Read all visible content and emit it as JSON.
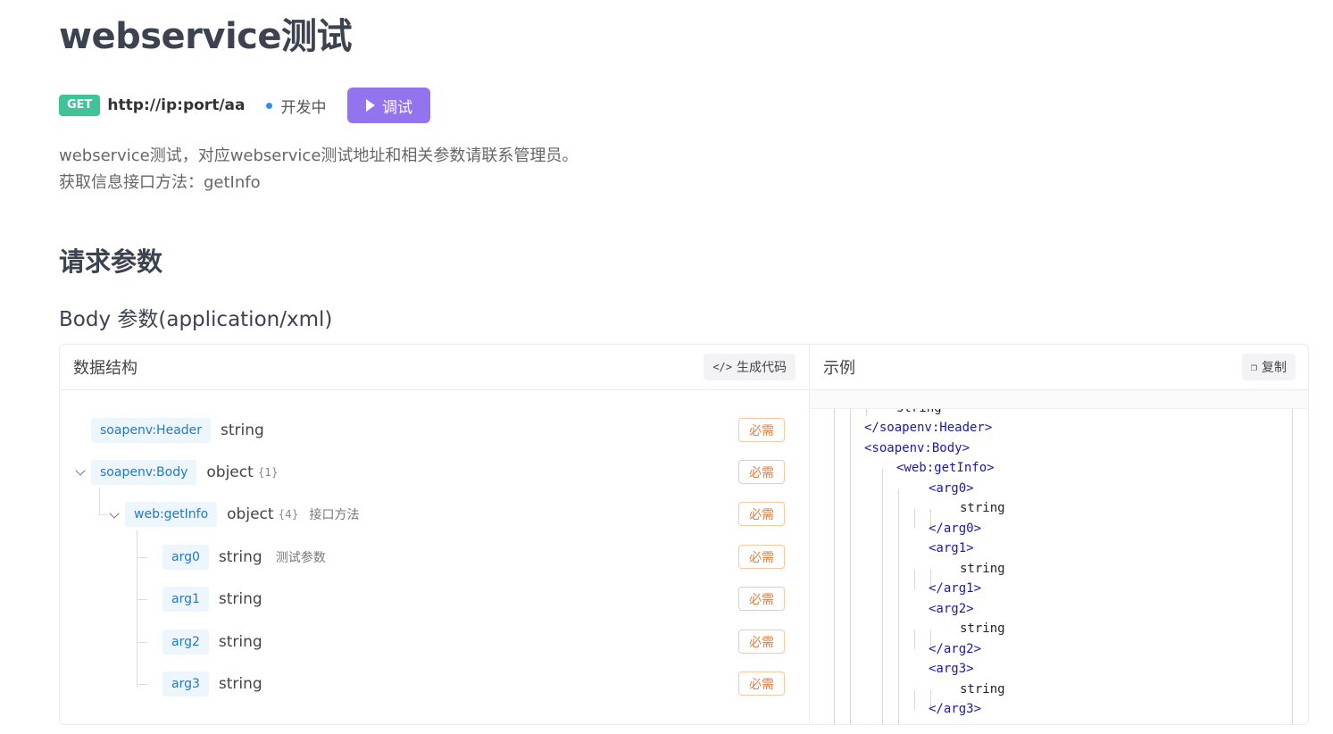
{
  "page": {
    "title": "webservice测试"
  },
  "endpoint": {
    "method": "GET",
    "url": "http://ip:port/aa",
    "status": "开发中",
    "debug_label": "调试"
  },
  "description": {
    "line1": "webservice测试，对应webservice测试地址和相关参数请联系管理员。",
    "line2": "获取信息接口方法：getInfo"
  },
  "request": {
    "section_title": "请求参数",
    "body_title": "Body 参数(application/xml)"
  },
  "schema_pane": {
    "title": "数据结构",
    "generate_code_label": "生成代码",
    "required_label": "必需",
    "rows": [
      {
        "name": "soapenv:Header",
        "type": "string",
        "count": "",
        "desc": ""
      },
      {
        "name": "soapenv:Body",
        "type": "object",
        "count": "{1}",
        "desc": ""
      },
      {
        "name": "web:getInfo",
        "type": "object",
        "count": "{4}",
        "desc": "接口方法"
      },
      {
        "name": "arg0",
        "type": "string",
        "count": "",
        "desc": "测试参数"
      },
      {
        "name": "arg1",
        "type": "string",
        "count": "",
        "desc": ""
      },
      {
        "name": "arg2",
        "type": "string",
        "count": "",
        "desc": ""
      },
      {
        "name": "arg3",
        "type": "string",
        "count": "",
        "desc": ""
      }
    ]
  },
  "example_pane": {
    "title": "示例",
    "copy_label": "复制",
    "code_lines": [
      {
        "text": "string",
        "kind": "text"
      },
      {
        "text": "</soapenv:Header>",
        "kind": "tag"
      },
      {
        "text": "<soapenv:Body>",
        "kind": "tag"
      },
      {
        "text": "<web:getInfo>",
        "kind": "tag"
      },
      {
        "text": "<arg0>",
        "kind": "tag"
      },
      {
        "text": "string",
        "kind": "text"
      },
      {
        "text": "</arg0>",
        "kind": "tag"
      },
      {
        "text": "<arg1>",
        "kind": "tag"
      },
      {
        "text": "string",
        "kind": "text"
      },
      {
        "text": "</arg1>",
        "kind": "tag"
      },
      {
        "text": "<arg2>",
        "kind": "tag"
      },
      {
        "text": "string",
        "kind": "text"
      },
      {
        "text": "</arg2>",
        "kind": "tag"
      },
      {
        "text": "<arg3>",
        "kind": "tag"
      },
      {
        "text": "string",
        "kind": "text"
      },
      {
        "text": "</arg3>",
        "kind": "tag"
      }
    ]
  }
}
